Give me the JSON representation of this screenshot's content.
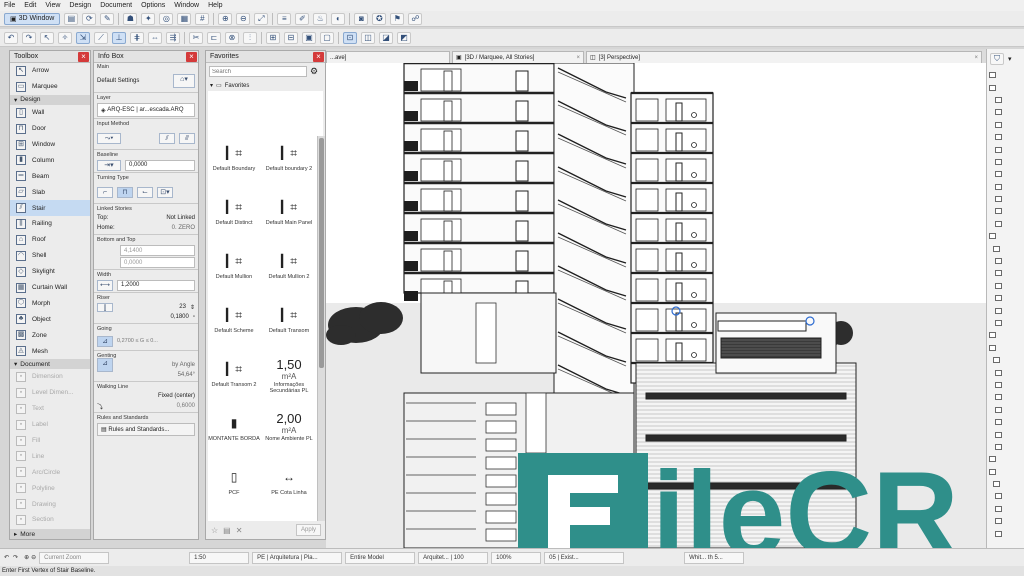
{
  "menu": [
    "File",
    "Edit",
    "View",
    "Design",
    "Document",
    "Options",
    "Window",
    "Help"
  ],
  "toolbar": {
    "view_selector": "3D Window"
  },
  "toolbox": {
    "title": "Toolbox",
    "top_tools": [
      "Arrow",
      "Marquee"
    ],
    "design_section": "Design",
    "design_tools": [
      "Wall",
      "Door",
      "Window",
      "Column",
      "Beam",
      "Slab",
      "Stair",
      "Railing",
      "Roof",
      "Shell",
      "Skylight",
      "Curtain Wall",
      "Morph",
      "Object",
      "Zone",
      "Mesh"
    ],
    "selected_tool": "Stair",
    "document_section": "Document",
    "document_tools": [
      "Dimension",
      "Level Dimen...",
      "Text",
      "Label",
      "Fill",
      "Line",
      "Arc/Circle",
      "Polyline",
      "Drawing",
      "Section"
    ],
    "more": "More"
  },
  "infobox": {
    "title": "Info Box",
    "main_label": "Main",
    "default_settings": "Default Settings",
    "layer_label": "Layer",
    "layer_value": "ARQ-ESC | ar...escada.ARQ",
    "input_method_label": "Input Method",
    "baseline_label": "Baseline",
    "baseline_value": "0,0000",
    "turning_type_label": "Turning Type",
    "linked_stories_label": "Linked Stories",
    "top_label": "Top:",
    "top_value": "Not Linked",
    "home_label": "Home:",
    "home_value": "0. ZERO",
    "bottom_top_label": "Bottom and Top",
    "bottom_top_value1": "4,1400",
    "bottom_top_value2": "0,0000",
    "width_label": "Width",
    "width_value": "1,2000",
    "riser_label": "Riser",
    "riser_count": "23",
    "riser_height": "0,1800",
    "going_label": "Going",
    "going_value": "0,2700 ≤ G ≤ 0...",
    "genting_label": "Genting",
    "genting_value": "by Angle",
    "genting_angle": "54,64°",
    "walking_line_label": "Walking Line",
    "walking_line_value": "Fixed (center)",
    "walking_line_offset": "0,6000",
    "rules_label": "Rules and Standards",
    "rules_button": "Rules and Standards..."
  },
  "favorites": {
    "title": "Favorites",
    "search_placeholder": "Search",
    "folder": "Favorites",
    "items": [
      {
        "label": "Default Boundary"
      },
      {
        "label": "Default boundary 2"
      },
      {
        "label": "Default Distinct"
      },
      {
        "label": "Default Main Panel"
      },
      {
        "label": "Default Mullion"
      },
      {
        "label": "Default Mullion 2"
      },
      {
        "label": "Default Scheme"
      },
      {
        "label": "Default Transom"
      },
      {
        "label": "Default Transom 2"
      },
      {
        "label": "Informações Secundárias PL",
        "big": "1,50",
        "unit": "m²A"
      },
      {
        "label": "MONTANTE BORDA"
      },
      {
        "label": "Nome Ambiente PL",
        "big": "2,00",
        "unit": "m²A"
      },
      {
        "label": "PCF"
      },
      {
        "label": "PE Cota Linha"
      }
    ],
    "apply": "Apply"
  },
  "tabs": [
    {
      "label": "...ave]"
    },
    {
      "label": "[3D / Marquee, All Stories]"
    },
    {
      "label": "[3] Perspective]"
    }
  ],
  "status": {
    "current_zoom": "Current Zoom",
    "scale": "1:50",
    "layer_combo": "PE | Arquitetura | Pla...",
    "model": "Entire Model",
    "arch": "Arquitet... | 100",
    "zoom_pct": "100%",
    "pen": "05 | Exist...",
    "renovation": "Whit... th 5..."
  },
  "hint": "Enter First Vertex of Stair Baseline.",
  "watermark": {
    "text": "ileCR",
    "color": "#2f8f8a"
  }
}
